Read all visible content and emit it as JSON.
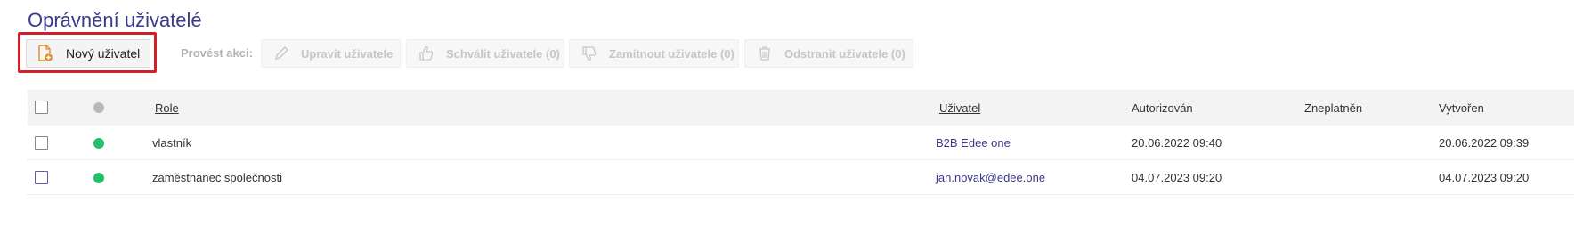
{
  "page": {
    "title": "Oprávnění uživatelé"
  },
  "toolbar": {
    "new_user_label": "Nový uživatel",
    "actions_label": "Provést akci:",
    "edit_label": "Upravit uživatele",
    "approve_label": "Schválit uživatele (0)",
    "reject_label": "Zamítnout uživatele (0)",
    "delete_label": "Odstranit uživatele (0)"
  },
  "table": {
    "columns": {
      "role": "Role",
      "user": "Uživatel",
      "authorized": "Autorizován",
      "invalidated": "Zneplatněn",
      "created": "Vytvořen"
    },
    "rows": [
      {
        "status": "active",
        "role": "vlastník",
        "user": "B2B Edee one",
        "authorized": "20.06.2022 09:40",
        "invalidated": "",
        "created": "20.06.2022 09:39"
      },
      {
        "status": "active",
        "role": "zaměstnanec společnosti",
        "user": "jan.novak@edee.one",
        "authorized": "04.07.2023 09:20",
        "invalidated": "",
        "created": "04.07.2023 09:20"
      }
    ]
  },
  "colors": {
    "title": "#3d3a8c",
    "highlight": "#d0202a",
    "status_active": "#22c06b",
    "status_header": "#b8b8b8",
    "new_user_icon": "#e08a2a"
  }
}
